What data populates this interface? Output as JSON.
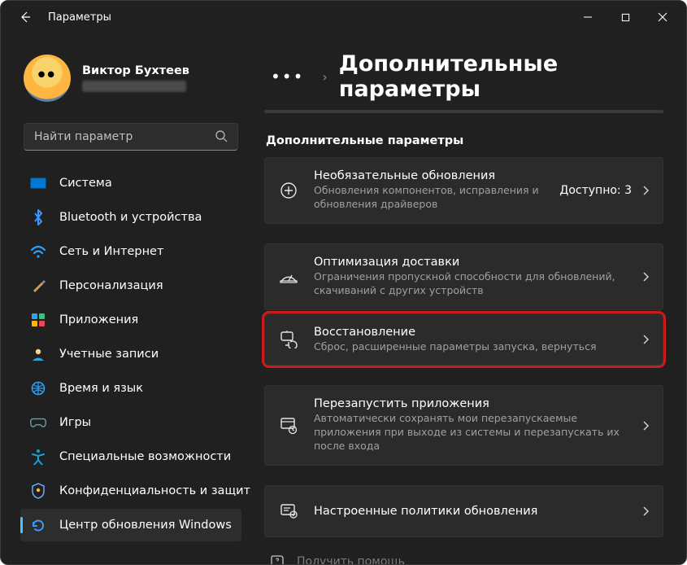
{
  "title_bar": {
    "title": "Параметры"
  },
  "profile": {
    "name": "Виктор Бухтеев"
  },
  "search": {
    "placeholder": "Найти параметр"
  },
  "sidebar": {
    "items": [
      {
        "label": "Система",
        "icon": "display-icon",
        "selected": false
      },
      {
        "label": "Bluetooth и устройства",
        "icon": "bluetooth-icon",
        "selected": false
      },
      {
        "label": "Сеть и Интернет",
        "icon": "network-icon",
        "selected": false
      },
      {
        "label": "Персонализация",
        "icon": "brush-icon",
        "selected": false
      },
      {
        "label": "Приложения",
        "icon": "apps-icon",
        "selected": false
      },
      {
        "label": "Учетные записи",
        "icon": "user-icon",
        "selected": false
      },
      {
        "label": "Время и язык",
        "icon": "globe-icon",
        "selected": false
      },
      {
        "label": "Игры",
        "icon": "gamepad-icon",
        "selected": false
      },
      {
        "label": "Специальные возможности",
        "icon": "accessibility-icon",
        "selected": false
      },
      {
        "label": "Конфиденциальность и защита",
        "icon": "shield-icon",
        "selected": false
      },
      {
        "label": "Центр обновления Windows",
        "icon": "update-icon",
        "selected": true
      }
    ]
  },
  "main": {
    "page_title": "Дополнительные параметры",
    "section_title": "Дополнительные параметры",
    "cards": [
      {
        "title": "Необязательные обновления",
        "subtitle": "Обновления компонентов, исправления и обновления драйверов",
        "badge": "Доступно: 3",
        "highlight": false
      },
      {
        "title": "Оптимизация доставки",
        "subtitle": "Ограничения пропускной способности для обновлений, скачиваний с других устройств",
        "badge": "",
        "highlight": false
      },
      {
        "title": "Восстановление",
        "subtitle": "Сброс, расширенные параметры запуска, вернуться",
        "badge": "",
        "highlight": true
      },
      {
        "title": "Перезапустить приложения",
        "subtitle": "Автоматически сохранять мои перезапускаемые приложения при выходе из системы и перезапускать их после входа",
        "badge": "",
        "highlight": false
      },
      {
        "title": "Настроенные политики обновления",
        "subtitle": "",
        "badge": "",
        "highlight": false
      }
    ],
    "help_link": "Получить помощь"
  }
}
